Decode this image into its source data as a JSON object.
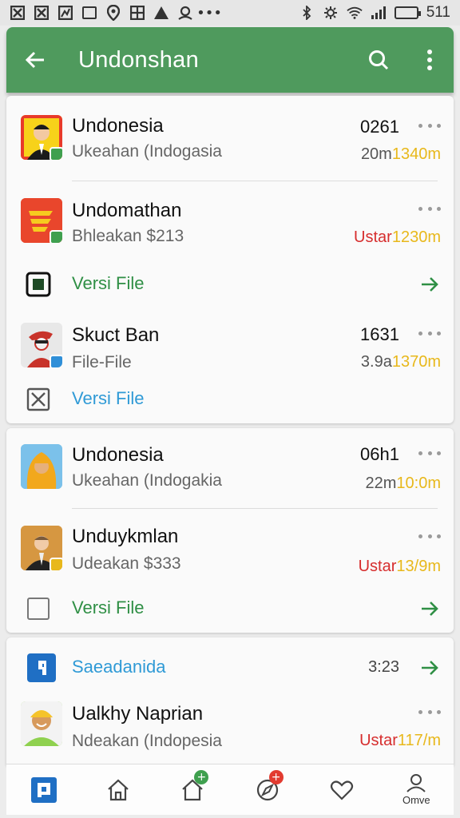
{
  "status_bar": {
    "left_icons": [
      "x-box-icon",
      "x-box-icon",
      "chart-icon",
      "square-icon",
      "location-icon",
      "grid-icon",
      "triangle-icon",
      "people-icon",
      "more-icon"
    ],
    "right_icons": [
      "bluetooth-icon",
      "settings-icon",
      "wifi-icon",
      "signal-icon",
      "battery-icon"
    ],
    "battery_level": 0.9,
    "time": "511"
  },
  "app_bar": {
    "title": "Undonshan",
    "color": "#4f9a5d",
    "back_icon": "arrow-left-icon",
    "search_icon": "search-icon",
    "menu_icon": "more-vertical-icon"
  },
  "card1": {
    "item1": {
      "title": "Undonesia",
      "subtitle": "Ukeahan (Indogasia",
      "count": "0261",
      "meta_a": "20m",
      "meta_b": "1340m"
    },
    "item2": {
      "title": "Undomathan",
      "subtitle": "Bhleakan $213",
      "meta_a": "Ustar",
      "meta_b": "1230m"
    },
    "file1": {
      "label": "Versi File",
      "color": "#2f8f45"
    },
    "item3": {
      "title": "Skuct Ban",
      "subtitle": "File-File",
      "count": "1631",
      "meta_a": "3.9a",
      "meta_b": "1370m"
    },
    "file2": {
      "label": "Versi File",
      "color": "#2f9ad6"
    }
  },
  "card2": {
    "item1": {
      "title": "Undonesia",
      "subtitle": "Ukeahan (Indogakia",
      "count": "06h1",
      "meta_a": "22m",
      "meta_b": "10:0m"
    },
    "item2": {
      "title": "Unduykmlan",
      "subtitle": "Udeakan $333",
      "meta_a": "Ustar",
      "meta_b": "13/9m"
    },
    "file1": {
      "label": "Versi File",
      "color": "#2f8f45"
    }
  },
  "card3": {
    "link": {
      "label": "Saeadanida",
      "time": "3:23",
      "color": "#2f9ad6"
    },
    "item1": {
      "title": "Ualkhy Naprian",
      "subtitle": "Ndeakan (Indopesia",
      "meta_a": "Ustar",
      "meta_b": "117/m"
    }
  },
  "bottom_nav": {
    "items": [
      {
        "icon": "app-logo-icon"
      },
      {
        "icon": "home-icon"
      },
      {
        "icon": "home-add-icon",
        "badge": "+"
      },
      {
        "icon": "compass-icon",
        "badge": "+"
      },
      {
        "icon": "heart-icon"
      },
      {
        "icon": "profile-icon",
        "label": "Omve"
      }
    ]
  }
}
